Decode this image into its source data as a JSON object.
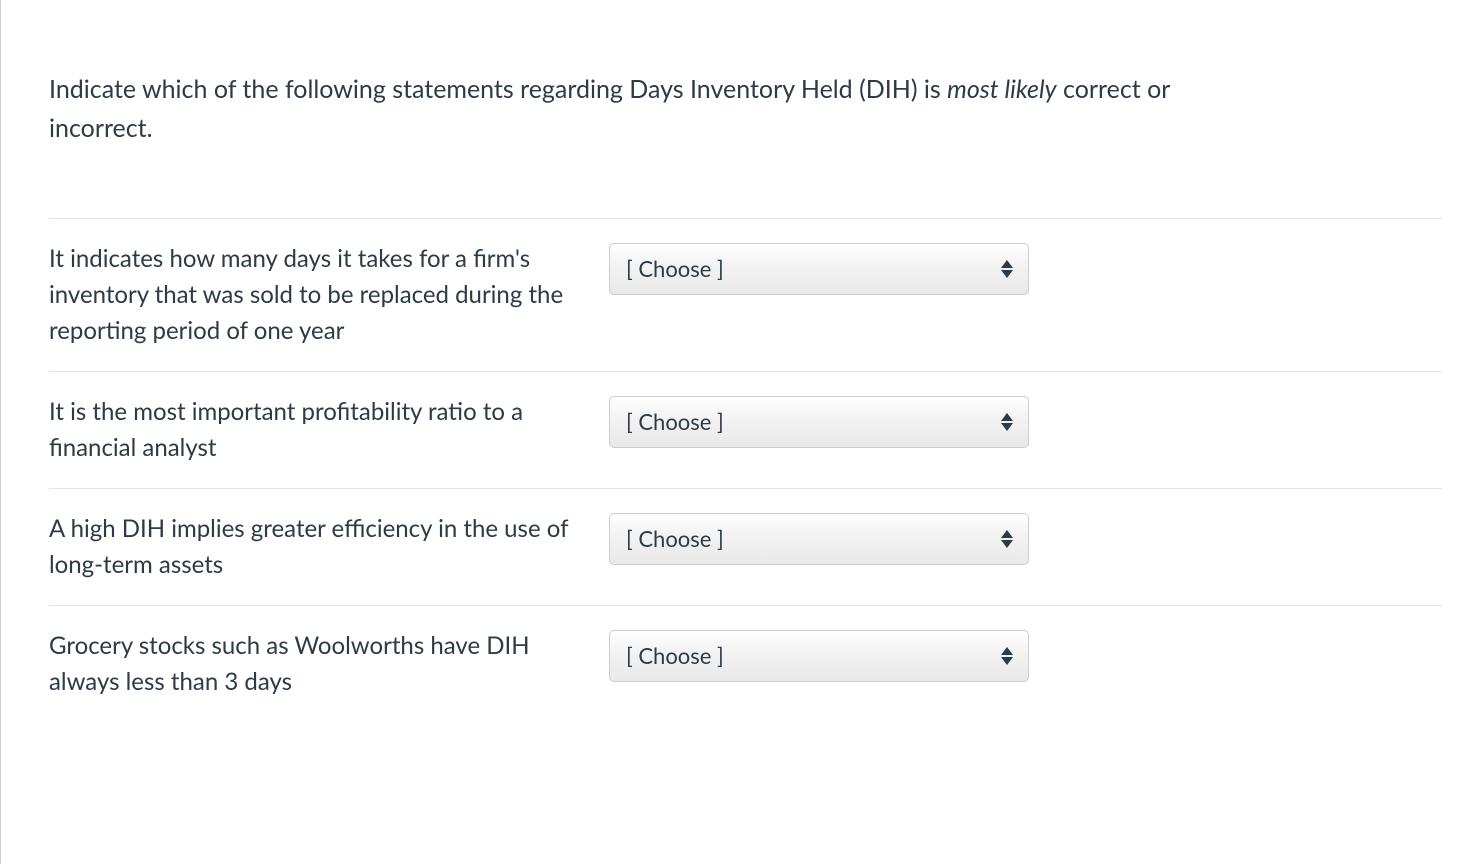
{
  "prompt": {
    "text_before_em": "Indicate which of the following statements regarding Days Inventory Held (DIH) is ",
    "em_text": "most likely",
    "text_after_em": " correct or incorrect."
  },
  "select_placeholder": "[ Choose ]",
  "rows": [
    {
      "label": "It indicates how many days it takes for a firm's inventory that was sold to be replaced during the reporting period of one year"
    },
    {
      "label": "It is the most important profitability ratio to a financial analyst"
    },
    {
      "label": "A high DIH implies greater efficiency in the use of long-term assets"
    },
    {
      "label": "Grocery stocks such as Woolworths have DIH always less than 3 days"
    }
  ]
}
